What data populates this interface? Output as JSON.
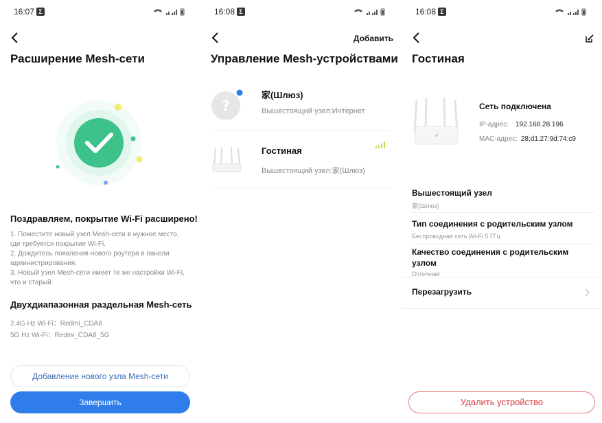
{
  "screens": {
    "s1": {
      "status_time": "16:07",
      "status_badge": "Σ",
      "title": "Расширение Mesh-сети",
      "congrats": "Поздравляем, покрытие Wi-Fi расширено!",
      "steps": [
        "1. Поместите новый узел Mesh-сети в нужное место, где требуется покрытие Wi-Fi.",
        "2. Дождитесь появления нового роутера в панели администрирования.",
        "3. Новый узел Mesh-сети имеет те же настройки Wi-Fi, что и старый."
      ],
      "dual_title": "Двухдиапазонная раздельная Mesh-сеть",
      "wifi_24": "2.4G Hz Wi-Fi：Redmi_CDA8",
      "wifi_5": "5G Hz Wi-Fi：Redmi_CDA8_5G",
      "add_node_button": "Добавление нового узла Mesh-сети",
      "finish_button": "Завершить"
    },
    "s2": {
      "status_time": "16:08",
      "status_badge": "Σ",
      "title": "Управление Mesh-устройствами",
      "add_label": "Добавить",
      "devices": [
        {
          "name": "家(Шлюз)",
          "parent": "Вышестоящий узел:Интернет",
          "icon": "unknown-device-icon"
        },
        {
          "name": "Гостиная",
          "parent": "Вышестоящий узел:家(Шлюз)",
          "icon": "router-icon"
        }
      ]
    },
    "s3": {
      "status_time": "16:08",
      "status_badge": "Σ",
      "title": "Гостиная",
      "net_status": "Сеть подключена",
      "ip_label": "IP-адрес:",
      "ip_value": "192.168.28.196",
      "mac_label": "MAC-адрес:",
      "mac_value": "28:d1:27:9d:74:c9",
      "parent_title": "Вышестоящий узел",
      "parent_value": "家(Шлюз)",
      "conn_type_title": "Тип соединения с родительским узлом",
      "conn_type_value": "Беспроводная сеть Wi-Fi 5 ГГц",
      "quality_title": "Качество соединения с родительским узлом",
      "quality_value": "Отличная",
      "reboot_label": "Перезагрузить",
      "delete_button": "Удалить устройство"
    }
  },
  "colors": {
    "accent": "#2f7dea",
    "success": "#3cc28a",
    "danger": "#d93b3b",
    "muted": "#888888"
  }
}
